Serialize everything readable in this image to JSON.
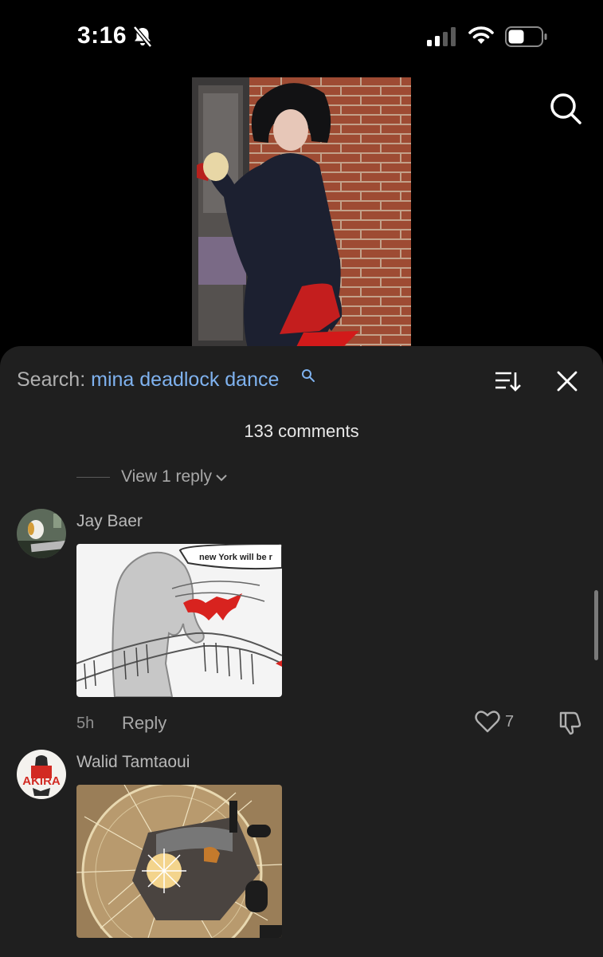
{
  "status_bar": {
    "time": "3:16"
  },
  "search": {
    "label": "Search:",
    "query": "mina deadlock dance"
  },
  "comments": {
    "count_label": "133 comments",
    "view_reply_label": "View 1 reply",
    "items": [
      {
        "username": "Jay Baer",
        "gif_caption": "new York will be r",
        "time": "5h",
        "reply_label": "Reply",
        "likes": "7"
      },
      {
        "username": "Walid Tamtaoui",
        "avatar_text": "AKIRA"
      }
    ]
  },
  "colors": {
    "sheet_bg": "#1f1f1f",
    "query_link": "#7fb2ef",
    "secondary_text": "#a8a8a8"
  },
  "icons": [
    "bell-slash-icon",
    "cellular-signal-icon",
    "wifi-icon",
    "battery-icon",
    "search-icon",
    "sort-icon",
    "close-icon",
    "chevron-down-icon",
    "heart-icon",
    "thumbs-down-icon"
  ]
}
